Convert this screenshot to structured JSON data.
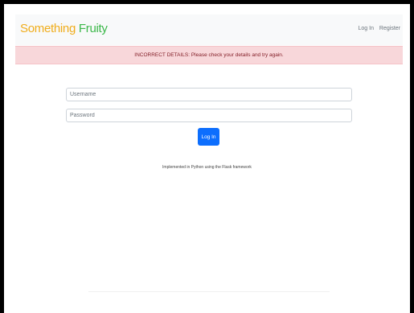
{
  "navbar": {
    "brand_word1": "Something",
    "brand_word2": "Fruity",
    "login_link": "Log In",
    "register_link": "Register"
  },
  "alert": {
    "message": "INCORRECT DETAILS: Please check your details and try again."
  },
  "form": {
    "username_placeholder": "Username",
    "password_placeholder": "Password",
    "submit_label": "Log In"
  },
  "footer": {
    "note": "Implemented in Python using the Flask framework"
  },
  "colors": {
    "brand_word1": "#f0ad1c",
    "brand_word2": "#3cb84a",
    "alert_bg": "#f8d7da",
    "primary_button": "#0d6efd"
  }
}
